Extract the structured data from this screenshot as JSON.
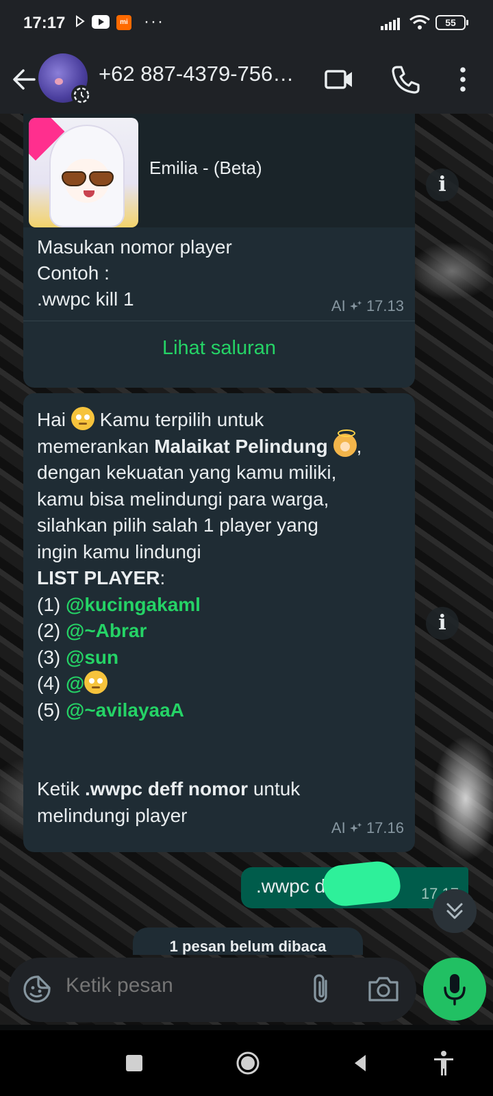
{
  "status_bar": {
    "time": "17:17",
    "more": "···",
    "battery": "55",
    "icons": [
      "play-icon",
      "youtube-icon",
      "mi-icon",
      "signal-icon",
      "wifi-icon",
      "battery-icon"
    ]
  },
  "header": {
    "contact": "+62 887-4379-756…",
    "icons": [
      "back-arrow-icon",
      "avatar",
      "video-call-icon",
      "phone-icon",
      "more-vert-icon"
    ]
  },
  "messages": {
    "first": {
      "preview_title": "Emilia - (Beta)",
      "lines": [
        "Masukan nomor player",
        "Contoh :",
        ".wwpc kill 1"
      ],
      "ai_label": "AI",
      "time": "17.13",
      "channel_link": "Lihat saluran"
    },
    "second": {
      "l1a": "Hai",
      "l1b": "Kamu terpilih untuk",
      "l2a": "memerankan",
      "l2b": "Malaikat Pelindung",
      "l2c": ",",
      "l3": "dengan kekuatan yang kamu miliki,",
      "l4": "kamu bisa melindungi para warga,",
      "l5": "silahkan pilih salah 1 player yang",
      "l6": "ingin kamu lindungi",
      "list_heading": "LIST PLAYER",
      "list_colon": ":",
      "players": [
        {
          "num": "(1)",
          "name": "@kucingakaml"
        },
        {
          "num": "(2)",
          "name": "@~Abrar"
        },
        {
          "num": "(3)",
          "name": "@sun"
        },
        {
          "num": "(4)",
          "name": "@"
        },
        {
          "num": "(5)",
          "name": "@~avilayaaA"
        }
      ],
      "footer_a": "Ketik",
      "footer_b": ".wwpc deff nomor",
      "footer_c": "untuk",
      "footer_d": "melindungi player",
      "ai_label": "AI",
      "time": "17.16"
    },
    "sent": {
      "text": ".wwpc d",
      "time": "17.17"
    }
  },
  "unread_banner": "1 pesan belum dibaca",
  "composer": {
    "placeholder": "Ketik pesan"
  },
  "colors": {
    "accent": "#25d366",
    "bubble_in": "#1f2c34",
    "bubble_out": "#005c4b",
    "mic": "#21c063"
  }
}
